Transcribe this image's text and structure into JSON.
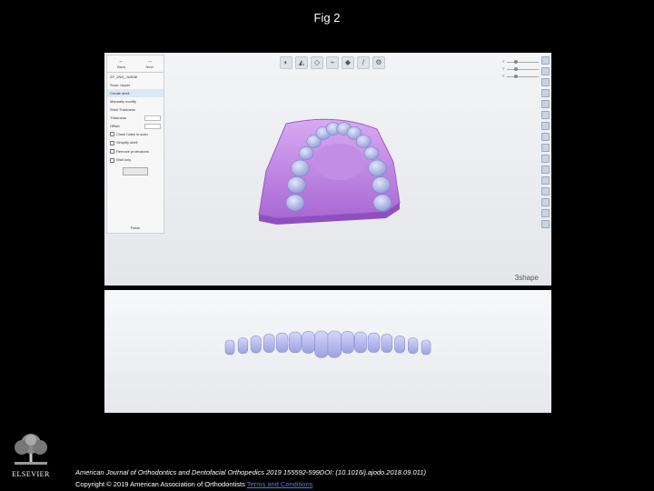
{
  "figure_title": "Fig 2",
  "software": {
    "side_panel": {
      "back_label": "Back",
      "next_label": "Next",
      "case_label": "ZP_2ND_JUN38",
      "scan_label": "Scan: Upper",
      "options": [
        "Create shell",
        "Manually modify"
      ],
      "section_label": "Shell Thickness",
      "thickness_label": "Thickness",
      "thickness_value": "0.75 mm",
      "offset_label": "Offset",
      "offset_value": "0.00 mm",
      "checkboxes": [
        "Close holes in scan",
        "Simplify shell",
        "Remove protrusions",
        "Wall only"
      ],
      "apply_label": "Apply",
      "footer_label": "Finish"
    },
    "logo": "3shape"
  },
  "footer": {
    "citation": "American Journal of Orthodontics and Dentofacial Orthopedics 2019 155592-599DOI: (10.1016/j.ajodo.2018.09.011)",
    "copyright_prefix": "Copyright © 2019 American Association of Orthodontists",
    "terms_link": "Terms and Conditions",
    "publisher_logo_text": "ELSEVIER"
  },
  "colors": {
    "model_base": "#c58be6",
    "teeth": "#aab6ee",
    "aligner": "#b8bdf0"
  }
}
